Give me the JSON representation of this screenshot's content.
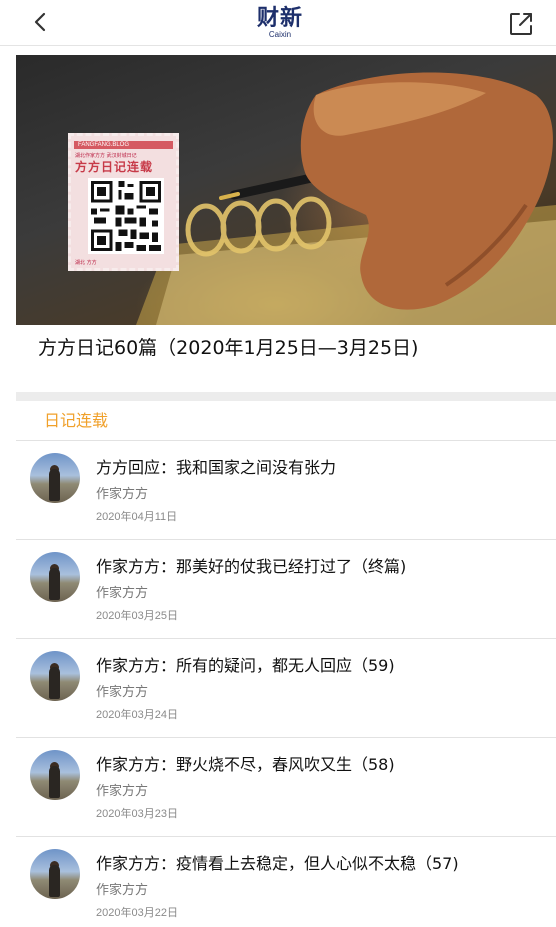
{
  "header": {
    "logo_cn": "财新",
    "logo_en": "Caixin"
  },
  "hero": {
    "poster": {
      "brand": "FANGFANG.BLOG",
      "subtitle": "湖北作家方方 武汉封城日记",
      "title": "方方日记连载",
      "footer": "湖北 方方"
    }
  },
  "article": {
    "title": "方方日记60篇（2020年1月25日—3月25日)"
  },
  "section": {
    "title": "日记连载"
  },
  "list": {
    "items": [
      {
        "title": "方方回应：我和国家之间没有张力",
        "author": "作家方方",
        "date": "2020年04月11日"
      },
      {
        "title": "作家方方：那美好的仗我已经打过了（终篇)",
        "author": "作家方方",
        "date": "2020年03月25日"
      },
      {
        "title": "作家方方：所有的疑问，都无人回应（59)",
        "author": "作家方方",
        "date": "2020年03月24日"
      },
      {
        "title": "作家方方：野火烧不尽，春风吹又生（58)",
        "author": "作家方方",
        "date": "2020年03月23日"
      },
      {
        "title": "作家方方：疫情看上去稳定，但人心似不太稳（57)",
        "author": "作家方方",
        "date": "2020年03月22日"
      }
    ]
  },
  "icons": {
    "back": "chevron-left-icon",
    "share": "share-external-icon"
  },
  "colors": {
    "brand": "#1d2f6b",
    "section_accent": "#f0a02a",
    "divider": "#ececec"
  }
}
